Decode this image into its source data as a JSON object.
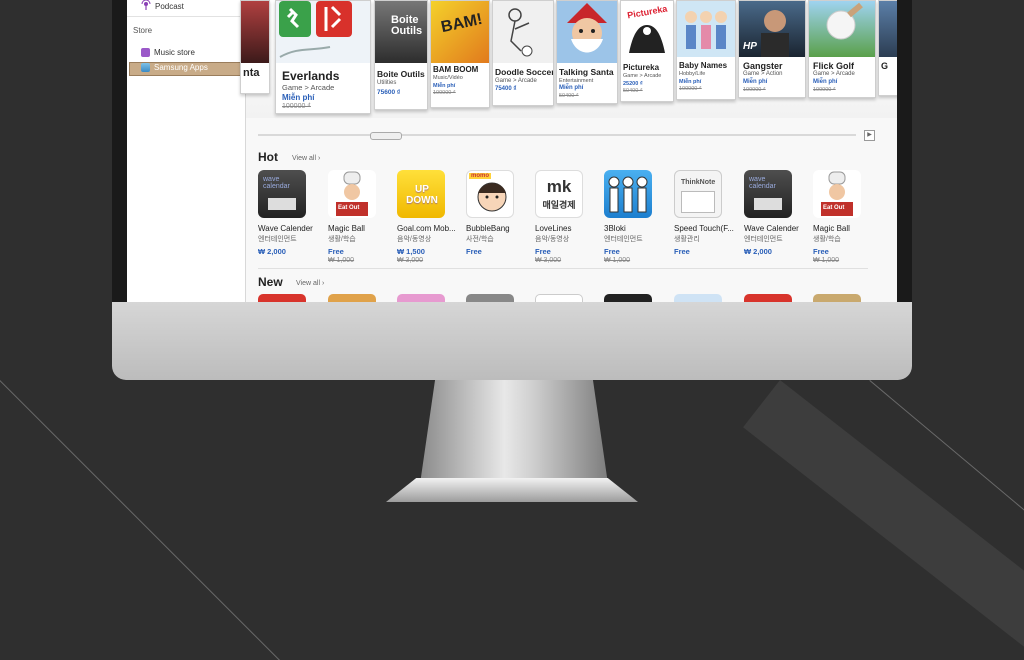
{
  "sidebar": {
    "podcast_label": "Podcast",
    "store_heading": "Store",
    "items": [
      {
        "label": "Music store",
        "icon": "music-store-icon"
      },
      {
        "label": "Samsung Apps",
        "icon": "samsung-apps-icon",
        "selected": true
      }
    ]
  },
  "featured": [
    {
      "title": "nta"
    },
    {
      "title": "Everlands",
      "category": "Game > Arcade",
      "price": "Miễn phí",
      "old_price": "100000 ₫"
    },
    {
      "title": "Boite Outils",
      "category": "Utilities",
      "price": "75600 ₫"
    },
    {
      "title": "BAM BOOM",
      "category": "Music/Vidéo",
      "price": "Miễn phí",
      "old_price": "100000 ₫"
    },
    {
      "title": "Doodle Soccer",
      "category": "Game > Arcade",
      "price": "75400 ₫"
    },
    {
      "title": "Talking Santa",
      "category": "Entertainment",
      "price": "Miễn phí",
      "old_price": "50400 ₫"
    },
    {
      "title": "Pictureka",
      "category": "Game > Arcade",
      "price": "25200 ₫",
      "old_price": "50400 ₫"
    },
    {
      "title": "Baby Names",
      "category": "Hobby/Life",
      "price": "Miễn phí",
      "old_price": "100000 ₫"
    },
    {
      "title": "Gangster",
      "category": "Game > Action",
      "price": "Miễn phí",
      "old_price": "100000 ₫"
    },
    {
      "title": "Flick Golf",
      "category": "Game > Arcade",
      "price": "Miễn phí",
      "old_price": "100000 ₫"
    },
    {
      "title": "G"
    }
  ],
  "hot": {
    "title": "Hot",
    "view_all": "View all ›",
    "apps": [
      {
        "name": "Wave Calender",
        "category": "엔터테인먼트",
        "price": "₩ 2,000",
        "old_price": ""
      },
      {
        "name": "Magic Ball",
        "category": "생활/학습",
        "price": "Free",
        "old_price": "₩ 1,000"
      },
      {
        "name": "Goal.com Mob...",
        "category": "음악/동영상",
        "price": "₩ 1,500",
        "old_price": "₩ 3,000"
      },
      {
        "name": "BubbleBang",
        "category": "사전/학습",
        "price": "Free",
        "old_price": ""
      },
      {
        "name": "LoveLines",
        "category": "음악/동영상",
        "price": "Free",
        "old_price": "₩ 3,000"
      },
      {
        "name": "3Bloki",
        "category": "엔터테인먼트",
        "price": "Free",
        "old_price": "₩ 1,000"
      },
      {
        "name": "Speed Touch(F...",
        "category": "생활관리",
        "price": "Free",
        "old_price": ""
      },
      {
        "name": "Wave Calender",
        "category": "엔터테인먼트",
        "price": "₩ 2,000",
        "old_price": ""
      },
      {
        "name": "Magic Ball",
        "category": "생활/학습",
        "price": "Free",
        "old_price": "₩ 1,000"
      }
    ]
  },
  "new": {
    "title": "New",
    "view_all": "View all ›"
  },
  "icon_text": {
    "wave_calendar": "wave calendar",
    "eat_out": "Eat Out",
    "up_down": "UP DOWN",
    "momo": "momo",
    "mk": "mk",
    "mk_korean": "매일경제",
    "thinknote": "ThinkNote",
    "boite": "Boite Outils",
    "bam": "BAM!",
    "hp": "HP",
    "pictureka": "Pictureka"
  }
}
